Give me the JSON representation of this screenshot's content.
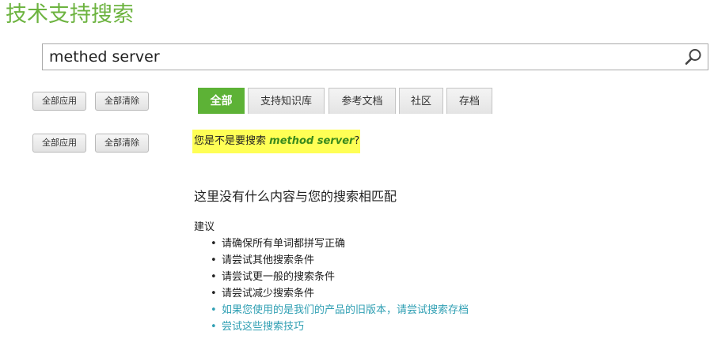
{
  "page": {
    "title": "技术支持搜索"
  },
  "search": {
    "value": "methed server",
    "icon": "search-icon"
  },
  "facet_buttons": {
    "row1": {
      "apply_label": "全部应用",
      "clear_label": "全部清除"
    },
    "row2": {
      "apply_label": "全部应用",
      "clear_label": "全部清除"
    }
  },
  "tabs": [
    {
      "label": "全部",
      "active": true
    },
    {
      "label": "支持知识库",
      "active": false
    },
    {
      "label": "参考文档",
      "active": false
    },
    {
      "label": "社区",
      "active": false
    },
    {
      "label": "存档",
      "active": false
    }
  ],
  "did_you_mean": {
    "prefix": "您是不是要搜索",
    "term": "method server",
    "suffix": "?"
  },
  "results": {
    "empty_message": "这里没有什么内容与您的搜索相匹配",
    "tips_heading": "建议",
    "tips": [
      {
        "text": "请确保所有单词都拼写正确",
        "link": false
      },
      {
        "text": "请尝试其他搜索条件",
        "link": false
      },
      {
        "text": "请尝试更一般的搜索条件",
        "link": false
      },
      {
        "text": "请尝试减少搜索条件",
        "link": false
      },
      {
        "text": "如果您使用的是我们的产品的旧版本，请尝试搜索存档",
        "link": true
      },
      {
        "text": "尝试这些搜索技巧",
        "link": true
      }
    ]
  },
  "colors": {
    "brand_green": "#6cb33f",
    "active_tab": "#5db236",
    "highlight": "#ffff55",
    "link": "#2f9fb3"
  }
}
